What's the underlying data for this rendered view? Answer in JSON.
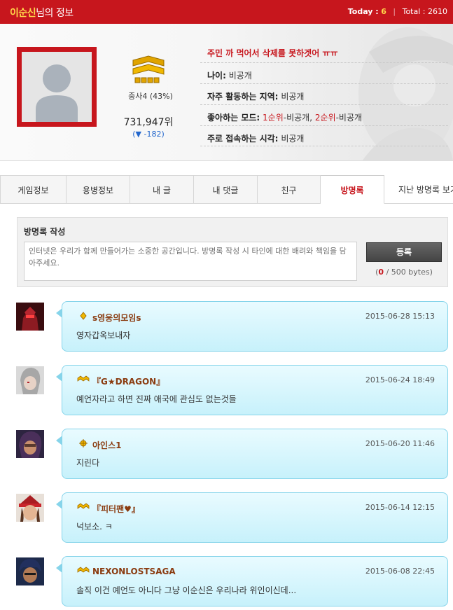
{
  "header": {
    "user_name": "이순신",
    "title_suffix": "님의 정보",
    "today_label": "Today :",
    "today_value": "6",
    "separator": "|",
    "total_label": "Total :",
    "total_value": "2610"
  },
  "profile": {
    "rank_text": "중사4 (43%)",
    "score": "731,947위",
    "score_change": "(▼ -182)",
    "status_message": "주민 까 먹어서 삭제를 못하겟어 ㅠㅠ",
    "age_label": "나이:",
    "age_value": "비공개",
    "region_label": "자주 활동하는 지역:",
    "region_value": "비공개",
    "mode_label": "좋아하는 모드:",
    "mode_rank1": "1순위",
    "mode_value1": "-비공개,",
    "mode_rank2": "2순위",
    "mode_value2": "-비공개",
    "time_label": "주로 접속하는 시각:",
    "time_value": "비공개"
  },
  "tabs": [
    "게임정보",
    "용병정보",
    "내 글",
    "내 댓글",
    "친구",
    "방명록",
    "지난 방명록 보기"
  ],
  "write": {
    "title": "방명록 작성",
    "placeholder": "인터넷은 우리가 함께 만들어가는 소중한 공간입니다. 방명록 작성 시 타인에 대한 배려와 책임을 담아주세요.",
    "submit_label": "등록",
    "bytes_open": "(",
    "bytes_current": "0",
    "bytes_rest": " / 500 bytes)"
  },
  "entries": [
    {
      "nick": "s영웅의모임s",
      "date": "2015-06-28  15:13",
      "text": "영자갑옥보내자"
    },
    {
      "nick": "『G★DRAGON』",
      "date": "2015-06-24  18:49",
      "text": "예언자라고 하면 진짜 애국에 관심도 없는것들"
    },
    {
      "nick": "아인스1",
      "date": "2015-06-20  11:46",
      "text": "지린다"
    },
    {
      "nick": "『피터팬♥』",
      "date": "2015-06-14  12:15",
      "text": "넉보소. ㅋ"
    },
    {
      "nick": "NEXONLOSTSAGA",
      "date": "2015-06-08  22:45",
      "text": "솔직 이건 예언도 아니다 그냥 이순신은 우리나라 위인이신데..."
    }
  ],
  "colors": {
    "brand_red": "#c7161d",
    "highlight_yellow": "#ffd54a",
    "bubble_blue": "#c7f1fb",
    "bubble_border": "#86d4ea"
  }
}
